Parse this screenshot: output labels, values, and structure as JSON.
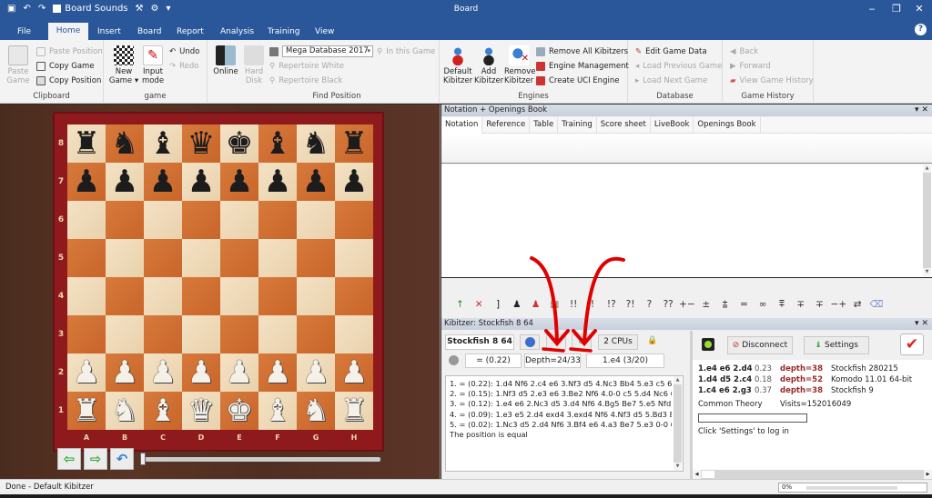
{
  "window": {
    "title": "Board",
    "quick_access": {
      "board_sounds_label": "Board Sounds",
      "board_sounds_checked": true
    },
    "controls": {
      "minimize": "‒",
      "restore": "❐",
      "close": "✕"
    }
  },
  "tabs": [
    {
      "label": "File",
      "active": false
    },
    {
      "label": "Home",
      "active": true
    },
    {
      "label": "Insert",
      "active": false
    },
    {
      "label": "Board",
      "active": false
    },
    {
      "label": "Report",
      "active": false
    },
    {
      "label": "Analysis",
      "active": false
    },
    {
      "label": "Training",
      "active": false
    },
    {
      "label": "View",
      "active": false
    }
  ],
  "ribbon": {
    "clipboard": {
      "label": "Clipboard",
      "paste_game": "Paste\nGame",
      "paste_position": "Paste Position",
      "copy_game": "Copy Game",
      "copy_position": "Copy Position"
    },
    "game": {
      "label": "game",
      "new_game": "New\nGame ▾",
      "input_mode": "Input\nmode",
      "undo": "Undo",
      "redo": "Redo"
    },
    "find_position": {
      "label": "Find Position",
      "online": "Online",
      "hard_disk": "Hard\nDisk",
      "database_select": "Mega Database 2017",
      "in_this_game": "In this Game",
      "repertoire_white": "Repertoire White",
      "repertoire_black": "Repertoire Black"
    },
    "engines": {
      "label": "Engines",
      "default_kibitzer": "Default\nKibitzer",
      "add_kibitzer": "Add\nKibitzer",
      "remove_kibitzer": "Remove\nKibitzer",
      "remove_all_kibitzers": "Remove All Kibitzers",
      "engine_management": "Engine Management",
      "create_uci_engine": "Create UCI Engine"
    },
    "database": {
      "label": "Database",
      "edit_game_data": "Edit Game Data",
      "load_previous_game": "Load Previous Game",
      "load_next_game": "Load Next Game"
    },
    "game_history": {
      "label": "Game History",
      "back": "Back",
      "forward": "Forward",
      "view_game_history": "View Game History"
    }
  },
  "board": {
    "ranks": [
      "8",
      "7",
      "6",
      "5",
      "4",
      "3",
      "2",
      "1"
    ],
    "files": [
      "A",
      "B",
      "C",
      "D",
      "E",
      "F",
      "G",
      "H"
    ],
    "position": [
      [
        "bR",
        "bN",
        "bB",
        "bQ",
        "bK",
        "bB",
        "bN",
        "bR"
      ],
      [
        "bP",
        "bP",
        "bP",
        "bP",
        "bP",
        "bP",
        "bP",
        "bP"
      ],
      [
        "",
        "",
        "",
        "",
        "",
        "",
        "",
        ""
      ],
      [
        "",
        "",
        "",
        "",
        "",
        "",
        "",
        ""
      ],
      [
        "",
        "",
        "",
        "",
        "",
        "",
        "",
        ""
      ],
      [
        "",
        "",
        "",
        "",
        "",
        "",
        "",
        ""
      ],
      [
        "wP",
        "wP",
        "wP",
        "wP",
        "wP",
        "wP",
        "wP",
        "wP"
      ],
      [
        "wR",
        "wN",
        "wB",
        "wQ",
        "wK",
        "wB",
        "wN",
        "wR"
      ]
    ],
    "slider_position": 0
  },
  "notation_pane": {
    "title": "Notation + Openings Book",
    "tabs": [
      "Notation",
      "Reference",
      "Table",
      "Training",
      "Score sheet",
      "LiveBook",
      "Openings Book"
    ],
    "active_tab": "Notation"
  },
  "annotations": [
    "↑",
    "✕",
    "]",
    "♟",
    "♟",
    "▦",
    "!!",
    "!",
    "!?",
    "?!",
    "?",
    "??",
    "+−",
    "±",
    "⩲",
    "=",
    "∞",
    "⩱",
    "∓",
    "∓",
    "−+",
    "⇄",
    "⌫"
  ],
  "kibitzer": {
    "title": "Kibitzer: Stockfish 8 64",
    "engine_name": "Stockfish 8 64",
    "cpus": "2 CPUs",
    "eval": "= (0.22)",
    "depth": "Depth=24/33",
    "current_move": "1.e4 (3/20)",
    "lines": [
      "1. = (0.22): 1.d4 Nf6 2.c4 e6 3.Nf3 d5 4.Nc3 Bb4 5.e3 c5 6.",
      "2. = (0.15): 1.Nf3 d5 2.e3 e6 3.Be2 Nf6 4.0-0 c5 5.d4 Nc6 6",
      "3. = (0.12): 1.e4 e6 2.Nc3 d5 3.d4 Nf6 4.Bg5 Be7 5.e5 Nfd7",
      "4. = (0.09): 1.e3 e5 2.d4 exd4 3.exd4 Nf6 4.Nf3 d5 5.Bd3 B",
      "5. = (0.02): 1.Nc3 d5 2.d4 Nf6 3.Bf4 e6 4.a3 Be7 5.e3 0-0 6"
    ],
    "summary": "The position is equal"
  },
  "livebook": {
    "disconnect_label": "Disconnect",
    "settings_label": "Settings",
    "rows": [
      {
        "moves": "1.e4 e6 2.d4",
        "eval": "0.23",
        "depth": "depth=38",
        "engine": "Stockfish 280215"
      },
      {
        "moves": "1.d4 d5 2.c4",
        "eval": "0.18",
        "depth": "depth=52",
        "engine": "Komodo 11.01 64-bit"
      },
      {
        "moves": "1.c4 e6 2.g3",
        "eval": "0.37",
        "depth": "depth=38",
        "engine": "Stockfish 9"
      }
    ],
    "common_theory": "Common Theory",
    "visits": "Visits=152016049",
    "login_hint": "Click 'Settings' to log in"
  },
  "status": {
    "text": "Done - Default Kibitzer",
    "progress_label": "0%",
    "progress_value": 0
  },
  "colors": {
    "titlebar": "#2a579a",
    "accent_red_annotation": "#e00000",
    "depth_text": "#9a2a2a"
  }
}
